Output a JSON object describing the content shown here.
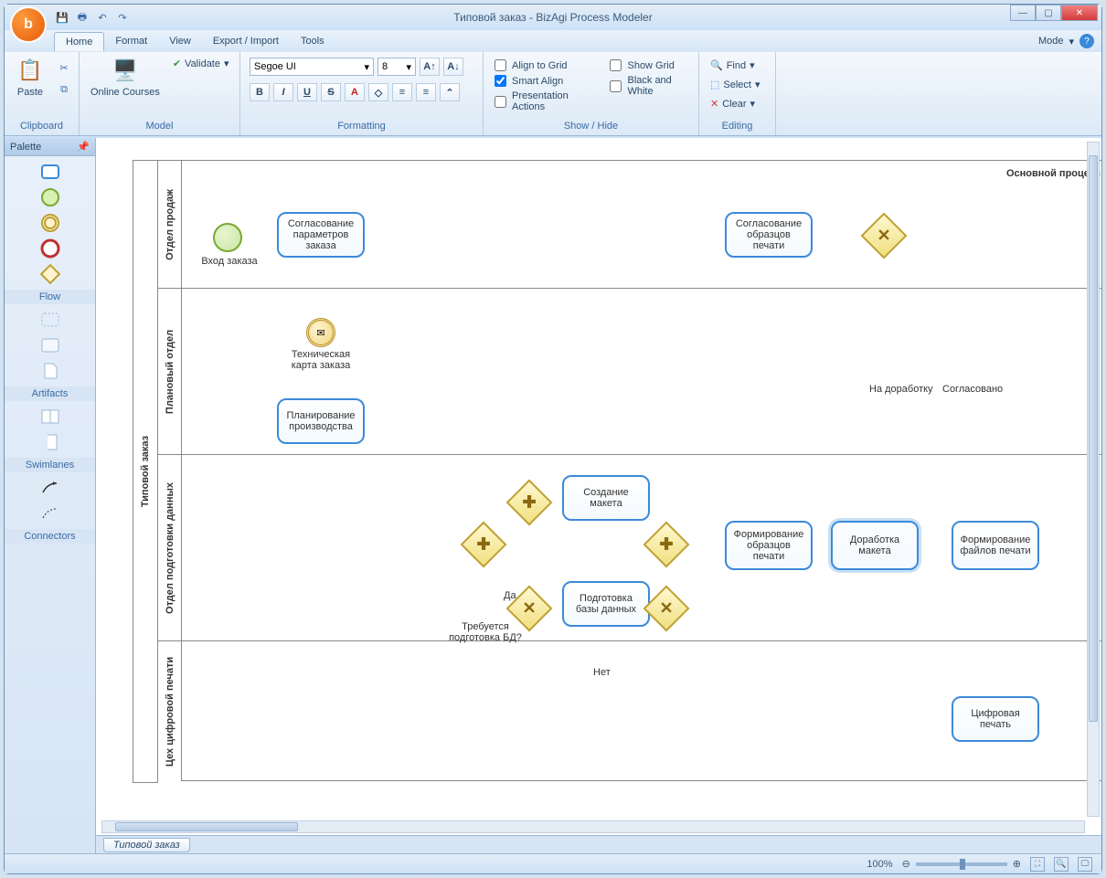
{
  "window": {
    "title": "Типовой заказ - BizAgi Process Modeler"
  },
  "menu": {
    "tabs": [
      "Home",
      "Format",
      "View",
      "Export / Import",
      "Tools"
    ],
    "mode": "Mode"
  },
  "ribbon": {
    "clipboard": {
      "paste": "Paste",
      "label": "Clipboard"
    },
    "model": {
      "online": "Online Courses",
      "validate": "Validate",
      "label": "Model"
    },
    "formatting": {
      "font": "Segoe UI",
      "size": "8",
      "label": "Formatting"
    },
    "showhide": {
      "align_grid": "Align to Grid",
      "smart_align": "Smart Align",
      "presentation": "Presentation Actions",
      "show_grid": "Show Grid",
      "bw": "Black and White",
      "label": "Show / Hide"
    },
    "editing": {
      "find": "Find",
      "select": "Select",
      "clear": "Clear",
      "label": "Editing"
    }
  },
  "palette": {
    "title": "Palette",
    "flow": "Flow",
    "artifacts": "Artifacts",
    "swimlanes": "Swimlanes",
    "connectors": "Connectors"
  },
  "diagram": {
    "pool": "Типовой заказ",
    "process_title": "Основной процесс",
    "lanes": [
      "Отдел продаж",
      "Плановый отдел",
      "Отдел подготовки данных",
      "Цех цифровой печати"
    ],
    "start_label": "Вход заказа",
    "tasks": {
      "t1": "Согласование параметров заказа",
      "t2": "Планирование производства",
      "t3": "Создание макета",
      "t4": "Подготовка базы данных",
      "t5": "Формирование образцов печати",
      "t6": "Согласование образцов печати",
      "t7": "Доработка макета",
      "t8": "Формирование файлов печати",
      "t9": "Цифровая печать"
    },
    "msg_label": "Техническая карта заказа",
    "gw_label": "Требуется подготовка БД?",
    "edge_yes": "Да",
    "edge_no": "Нет",
    "edge_rework": "На доработку",
    "edge_ok": "Согласовано"
  },
  "tab": "Типовой заказ",
  "status": {
    "zoom": "100%"
  }
}
